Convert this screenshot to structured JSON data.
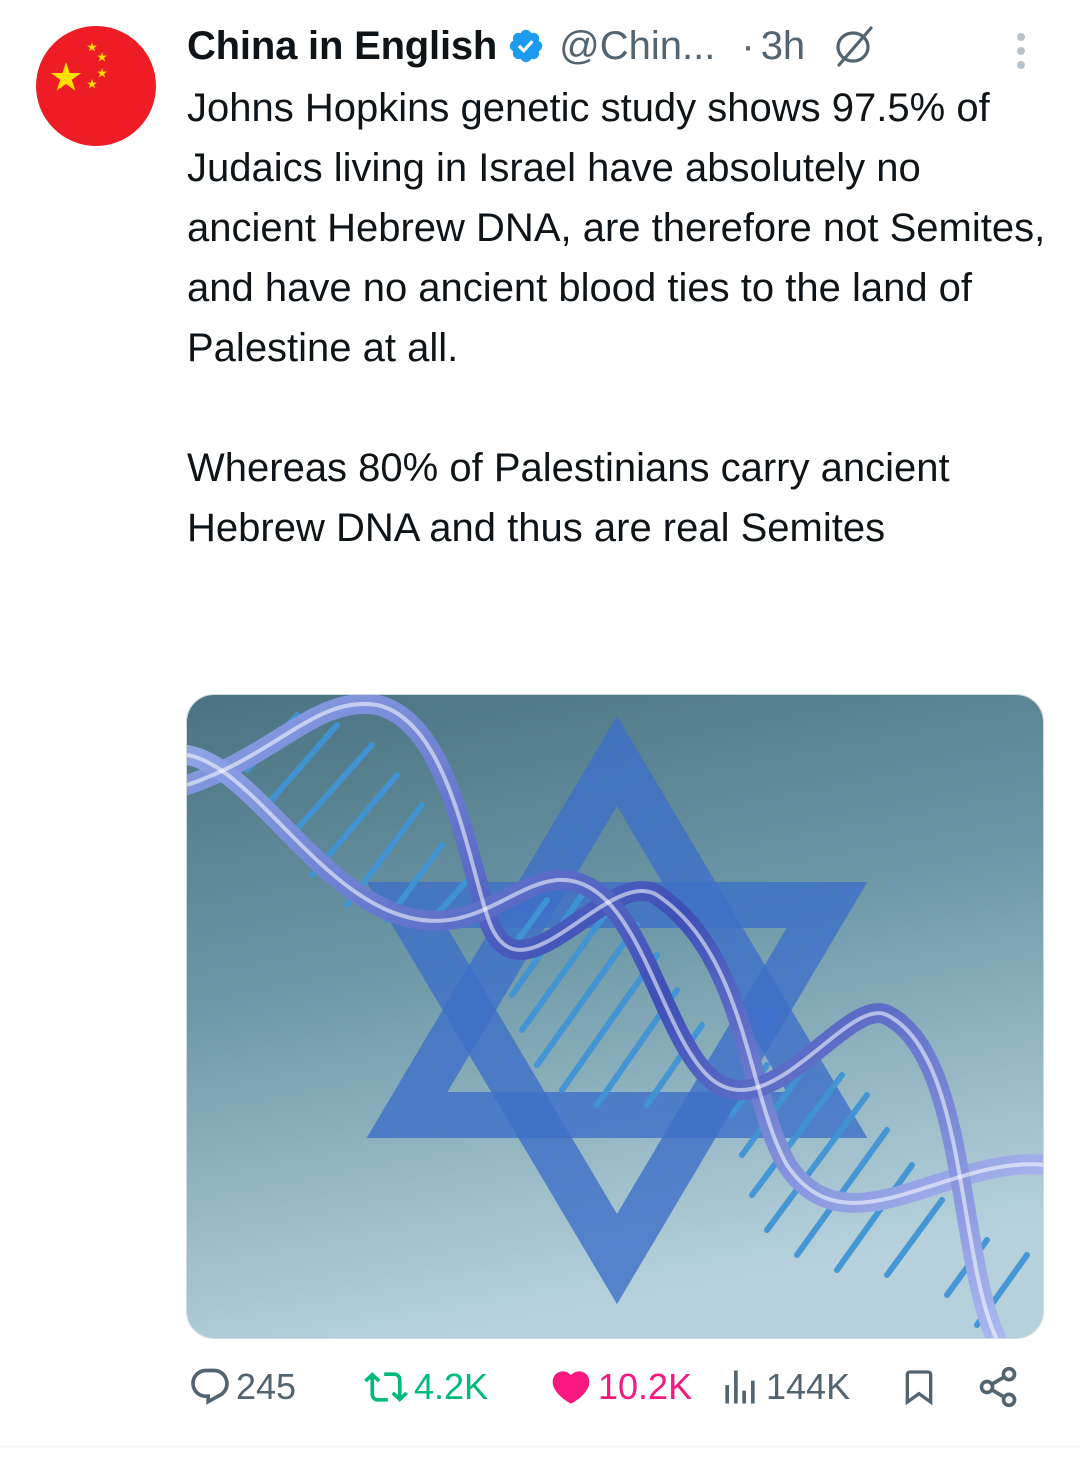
{
  "author": {
    "name": "China in English",
    "handle": "@Chin...",
    "separator": "·",
    "time": "3h",
    "avatar": "china-flag",
    "verified": true
  },
  "tweet": {
    "paragraphs": [
      "Johns Hopkins genetic study shows 97.5% of Judaics living in Israel have absolutely no ancient Hebrew DNA, are therefore not Semites, and have no ancient blood ties to the land of Palestine at all.",
      "Whereas 80% of Palestinians carry ancient Hebrew DNA and thus are real Semites"
    ],
    "media": {
      "subject": "dna-double-helix-over-star-of-david"
    }
  },
  "metrics": {
    "replies": "245",
    "reposts": "4.2K",
    "likes": "10.2K",
    "views": "144K"
  },
  "icons": {
    "verified": "verified-badge-icon",
    "grok": "grok-icon",
    "more": "more-vertical-icon",
    "reply": "reply-icon",
    "repost": "repost-icon",
    "like": "heart-icon",
    "views": "views-icon",
    "bookmark": "bookmark-icon",
    "share": "share-icon"
  },
  "colors": {
    "text": "#0f1419",
    "secondary": "#536471",
    "verified": "#1d9bf0",
    "repost": "#00ba7c",
    "like": "#f91880",
    "flag_red": "#ee1c25",
    "flag_star": "#ffde00"
  }
}
